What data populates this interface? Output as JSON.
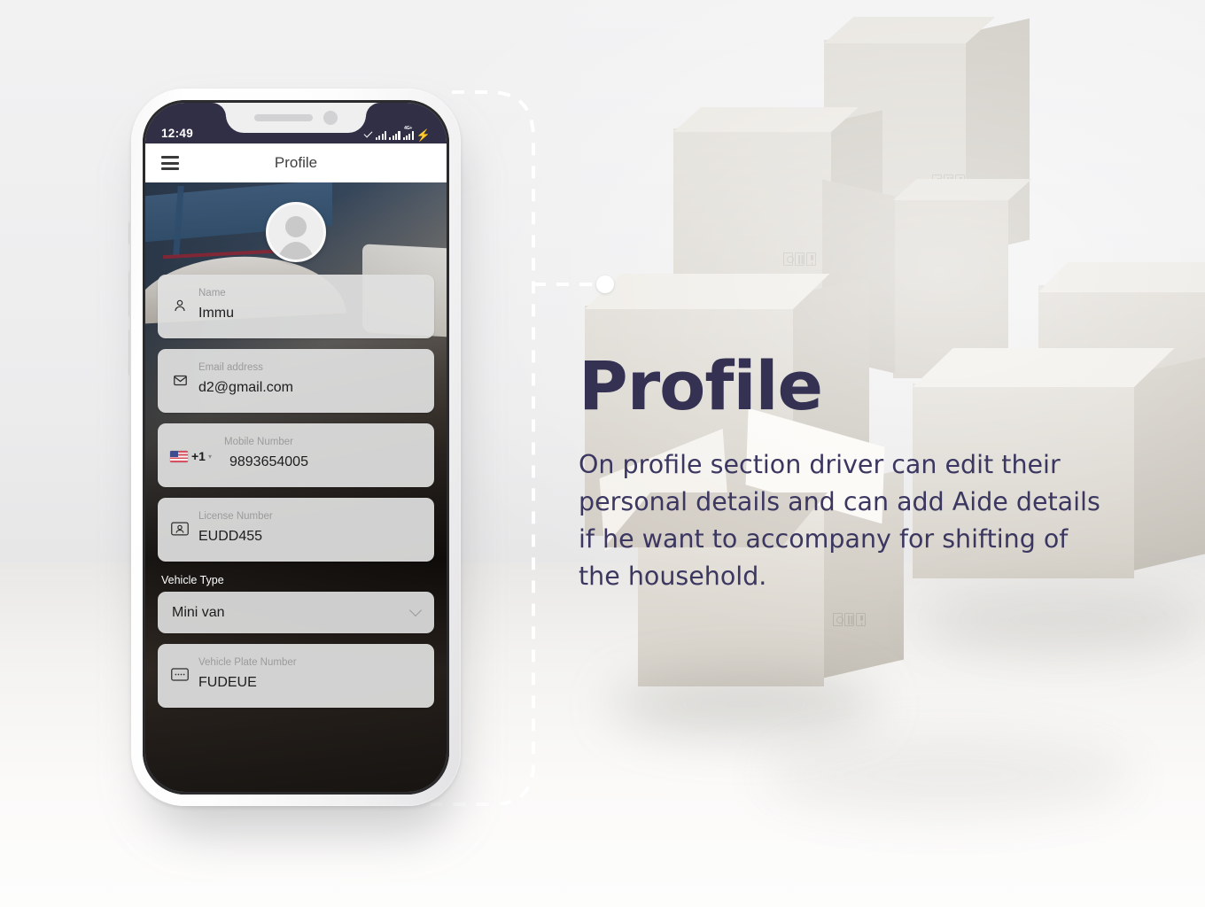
{
  "phone": {
    "status_bar": {
      "time": "12:49",
      "icons": [
        "check-icon",
        "mobile-data-icon",
        "signal-bars-icon",
        "signal-4g-icon",
        "charging-bolt-icon"
      ],
      "network_label": "4G+"
    },
    "app_bar": {
      "menu_icon": "hamburger-menu-icon",
      "title": "Profile"
    },
    "avatar": {
      "icon": "person-avatar-icon"
    },
    "form": {
      "fields": [
        {
          "icon": "person-icon",
          "label": "Name",
          "value": "Immu"
        },
        {
          "icon": "envelope-icon",
          "label": "Email address",
          "value": "d2@gmail.com"
        },
        {
          "icon": "flag-icon",
          "label": "Mobile Number",
          "value": "9893654005",
          "country_code": "+1",
          "country": "US"
        },
        {
          "icon": "id-card-icon",
          "label": "License Number",
          "value": "EUDD455"
        },
        {
          "icon": "plate-icon",
          "label": "Vehicle Plate Number",
          "value": "FUDEUE"
        }
      ],
      "vehicle_type": {
        "label": "Vehicle Type",
        "selected": "Mini van",
        "chevron": "chevron-down-icon"
      }
    }
  },
  "callout": {
    "title": "Profile",
    "body": "On profile section driver can edit their personal details and can add Aide details if he want to accompany for shifting of the household.",
    "title_color": "#353153",
    "body_color": "#3b3760"
  },
  "scene": {
    "background": "cardboard-moving-boxes-photo",
    "accent_dot": "connector-dot"
  }
}
